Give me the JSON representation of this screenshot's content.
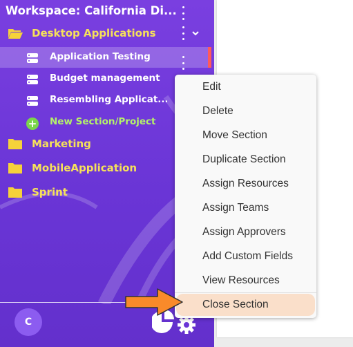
{
  "workspace": {
    "title": "Workspace: California Di..."
  },
  "folders": [
    {
      "label": "Desktop Applications",
      "expanded": true
    },
    {
      "label": "Marketing"
    },
    {
      "label": "MobileApplication"
    },
    {
      "label": "Sprint"
    }
  ],
  "sections": [
    {
      "label": "Application Testing",
      "active": true
    },
    {
      "label": "Budget management"
    },
    {
      "label": "Resembling Applicat..."
    }
  ],
  "new_section": {
    "label": "New Section/Project"
  },
  "user": {
    "avatar_initial": "C"
  },
  "context_menu": {
    "items": [
      "Edit",
      "Delete",
      "Move Section",
      "Duplicate Section",
      "Assign Resources",
      "Assign Teams",
      "Assign Approvers",
      "Add Custom Fields",
      "View Resources",
      "Close Section"
    ],
    "highlighted": "Close Section"
  },
  "colors": {
    "sidebar": "#6a35d6",
    "folder_text": "#f6e15a",
    "new_section_text": "#b4f06a",
    "highlight": "#fadfca",
    "arrow": "#f98a2a",
    "active_accent": "#ff5a5a"
  },
  "icons": {
    "folder": "folder-icon",
    "folder_open": "folder-open-icon",
    "section": "server-icon",
    "add": "plus-circle-icon",
    "more": "kebab-icon",
    "expand": "chevron-down-icon",
    "bottom": "pie-chart-gear-icon",
    "pointer": "arrow-right-icon"
  }
}
